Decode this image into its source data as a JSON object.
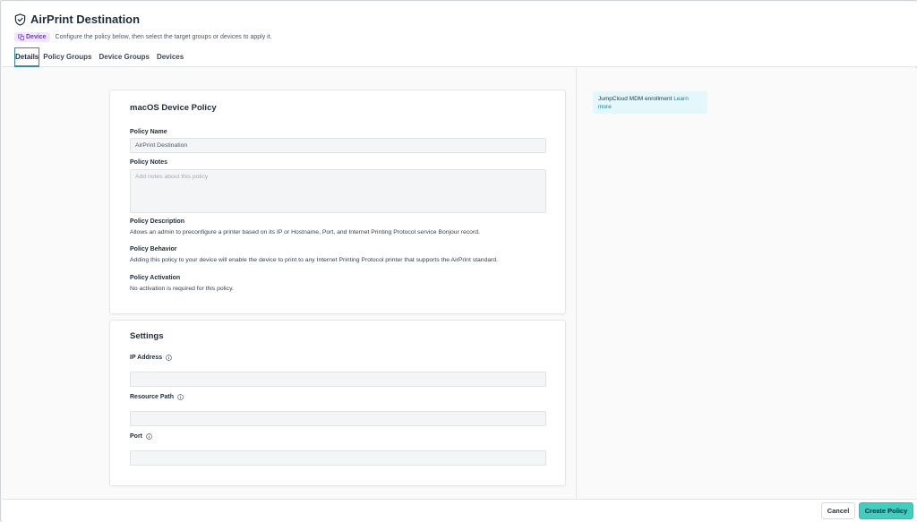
{
  "header": {
    "title": "AirPrint Destination",
    "badge": "Device",
    "subtitle": "Configure the policy below, then select the target groups or devices to apply it."
  },
  "tabs": [
    {
      "label": "Details",
      "active": true
    },
    {
      "label": "Policy Groups",
      "active": false
    },
    {
      "label": "Device Groups",
      "active": false
    },
    {
      "label": "Devices",
      "active": false
    }
  ],
  "policy_card": {
    "title": "macOS Device Policy",
    "name_label": "Policy Name",
    "name_value": "AirPrint Destination",
    "notes_label": "Policy Notes",
    "notes_placeholder": "Add notes about this policy",
    "description_label": "Policy Description",
    "description_text": "Allows an admin to preconfigure a printer based on its IP or Hostname, Port, and Internet Printing Protocol service Bonjour record.",
    "behavior_label": "Policy Behavior",
    "behavior_text": "Adding this policy to your device will enable the device to print to any Internet Printing Protocol printer that supports the AirPrint standard.",
    "activation_label": "Policy Activation",
    "activation_text": "No activation is required for this policy."
  },
  "settings_card": {
    "title": "Settings",
    "ip_label": "IP Address",
    "ip_value": "",
    "path_label": "Resource Path",
    "path_value": "",
    "port_label": "Port",
    "port_value": ""
  },
  "side": {
    "info_text": "JumpCloud MDM enrollment",
    "info_link": "Learn more"
  },
  "footer": {
    "cancel_label": "Cancel",
    "create_label": "Create Policy"
  },
  "colors": {
    "accent": "#3ecfc0",
    "tab_active": "#2e8fa3",
    "badge_bg": "#efe7fa",
    "badge_text": "#6f3cc4",
    "info_bg": "#e4f7fb",
    "link": "#1c7f9a"
  },
  "icons": {
    "title": "shield-icon",
    "badge": "device-icon",
    "field_info": "info-icon"
  }
}
